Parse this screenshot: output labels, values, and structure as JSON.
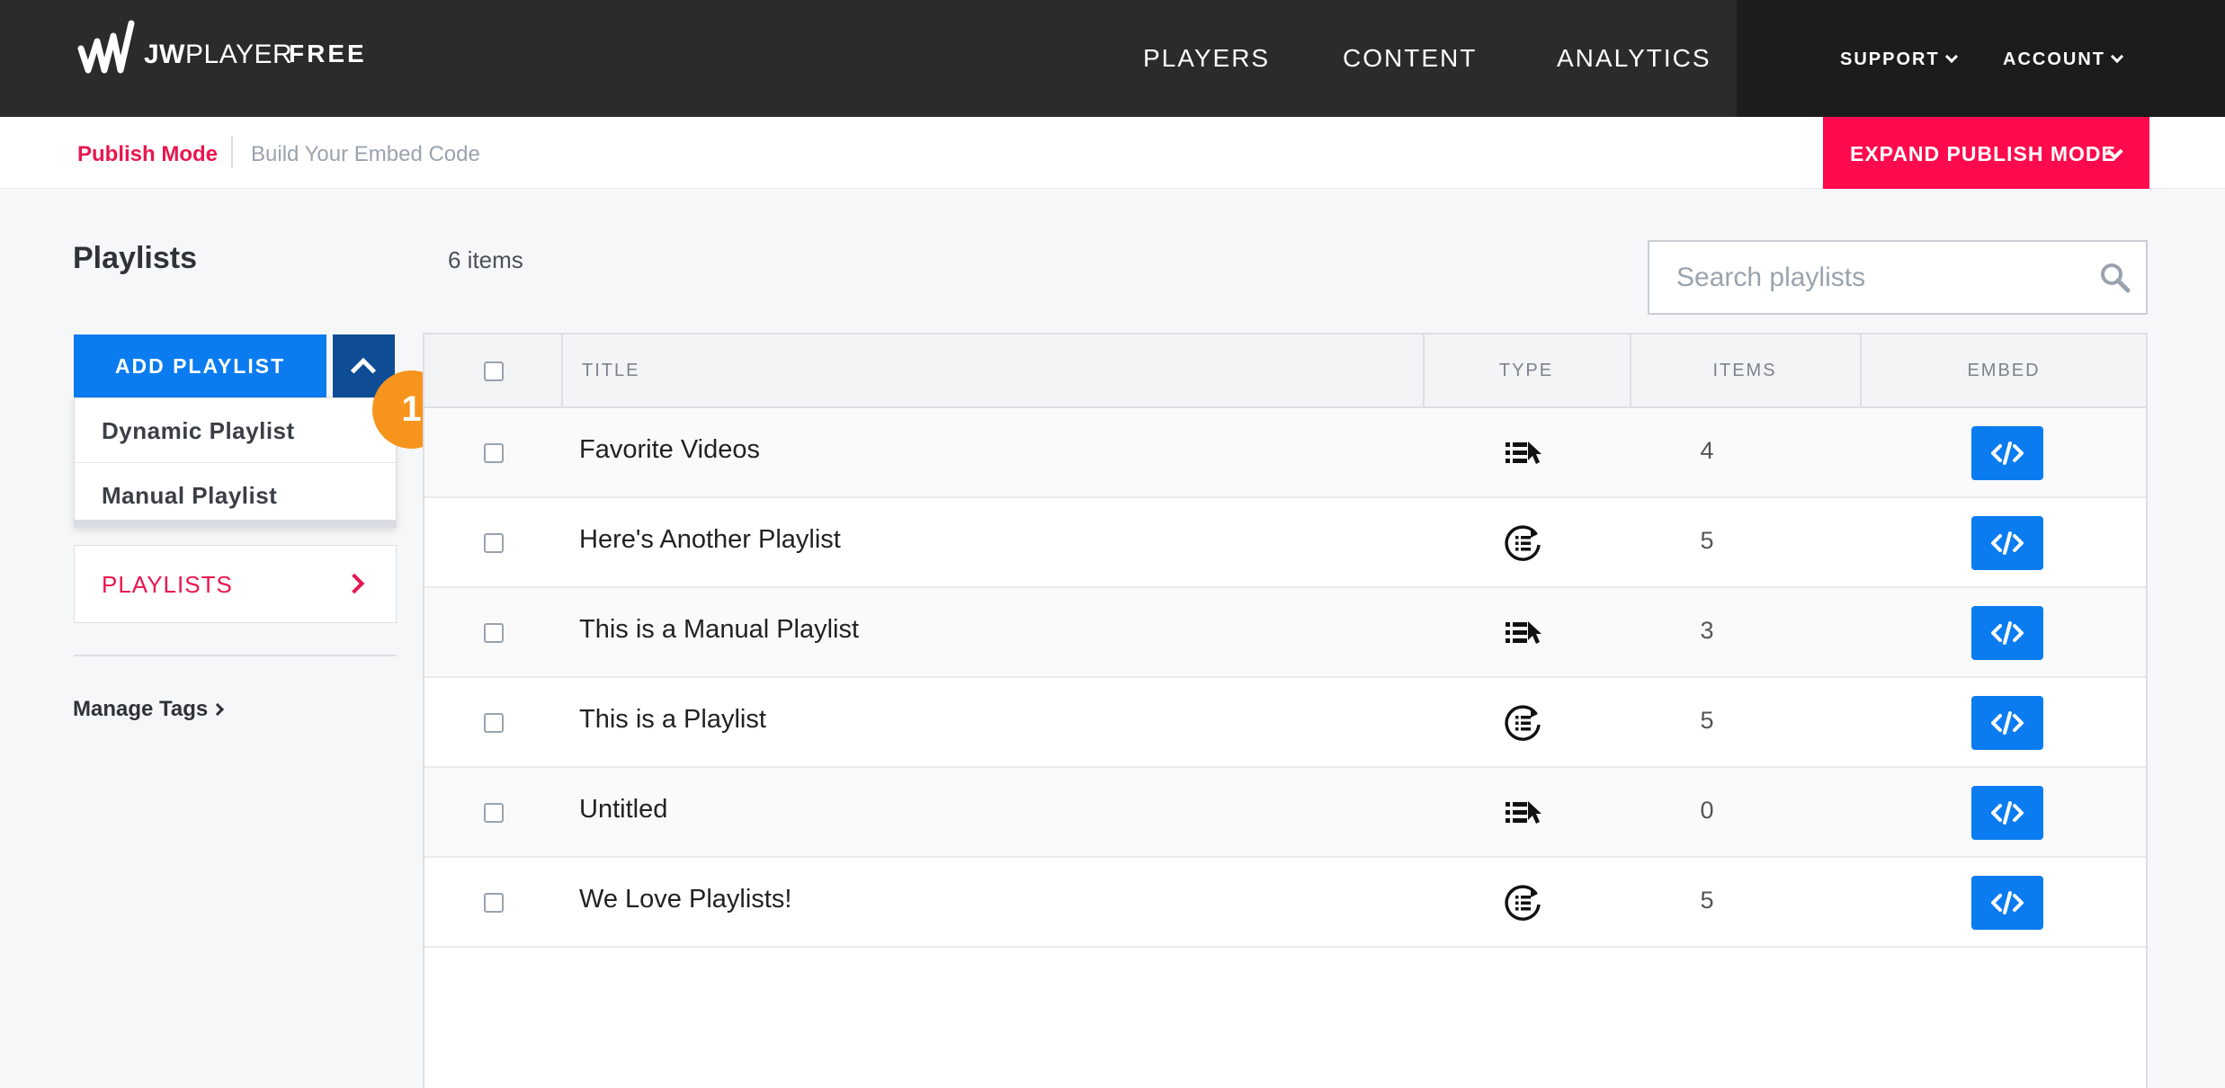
{
  "colors": {
    "accent_blue": "#0a7cf0",
    "accent_red": "#ff0a4d",
    "nav_bg": "#2b2b2b",
    "badge_orange": "#f7941d"
  },
  "nav": {
    "logo_icon": "jwplayer-logo-icon",
    "brand_bold": "JW",
    "brand_rest": "PLAYER",
    "tier": "FREE",
    "items": [
      "PLAYERS",
      "CONTENT",
      "ANALYTICS"
    ],
    "active": "CONTENT",
    "support": "SUPPORT",
    "account": "ACCOUNT"
  },
  "subbar": {
    "publish_mode": "Publish Mode",
    "build_embed": "Build Your Embed Code",
    "expand_button": "EXPAND PUBLISH MODE"
  },
  "sidebar": {
    "title": "Playlists",
    "add_button": "ADD PLAYLIST",
    "dropdown": [
      "Dynamic Playlist",
      "Manual Playlist"
    ],
    "step_badge": "1",
    "playlists_link": "PLAYLISTS",
    "manage_tags": "Manage Tags"
  },
  "main": {
    "item_count": "6 items",
    "search_placeholder": "Search playlists",
    "columns": [
      "TITLE",
      "TYPE",
      "ITEMS",
      "EMBED"
    ],
    "rows": [
      {
        "title": "Favorite Videos",
        "type": "manual",
        "items": "4"
      },
      {
        "title": "Here's Another Playlist",
        "type": "dynamic",
        "items": "5"
      },
      {
        "title": "This is a Manual Playlist",
        "type": "manual",
        "items": "3"
      },
      {
        "title": "This is a Playlist",
        "type": "dynamic",
        "items": "5"
      },
      {
        "title": "Untitled",
        "type": "manual",
        "items": "0"
      },
      {
        "title": "We Love Playlists!",
        "type": "dynamic",
        "items": "5"
      }
    ]
  }
}
